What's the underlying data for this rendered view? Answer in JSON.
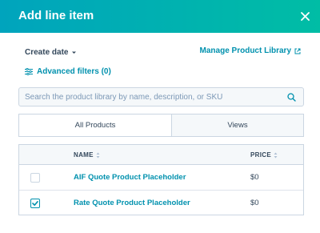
{
  "header": {
    "title": "Add line item",
    "close_icon": "close-icon"
  },
  "filters": {
    "create_date_label": "Create date",
    "manage_link_label": "Manage Product Library",
    "advanced_filters_label": "Advanced filters (0)"
  },
  "search": {
    "placeholder": "Search the product library by name, description, or SKU",
    "value": ""
  },
  "tabs": [
    {
      "label": "All Products",
      "active": true
    },
    {
      "label": "Views",
      "active": false
    }
  ],
  "table": {
    "columns": [
      "NAME",
      "PRICE"
    ],
    "rows": [
      {
        "name": "AIF Quote Product Placeholder",
        "price": "$0",
        "checked": false
      },
      {
        "name": "Rate Quote Product Placeholder",
        "price": "$0",
        "checked": true
      }
    ]
  },
  "colors": {
    "header_start": "#00a4bd",
    "header_end": "#00bda5",
    "link": "#0091ae",
    "text": "#33475b"
  }
}
